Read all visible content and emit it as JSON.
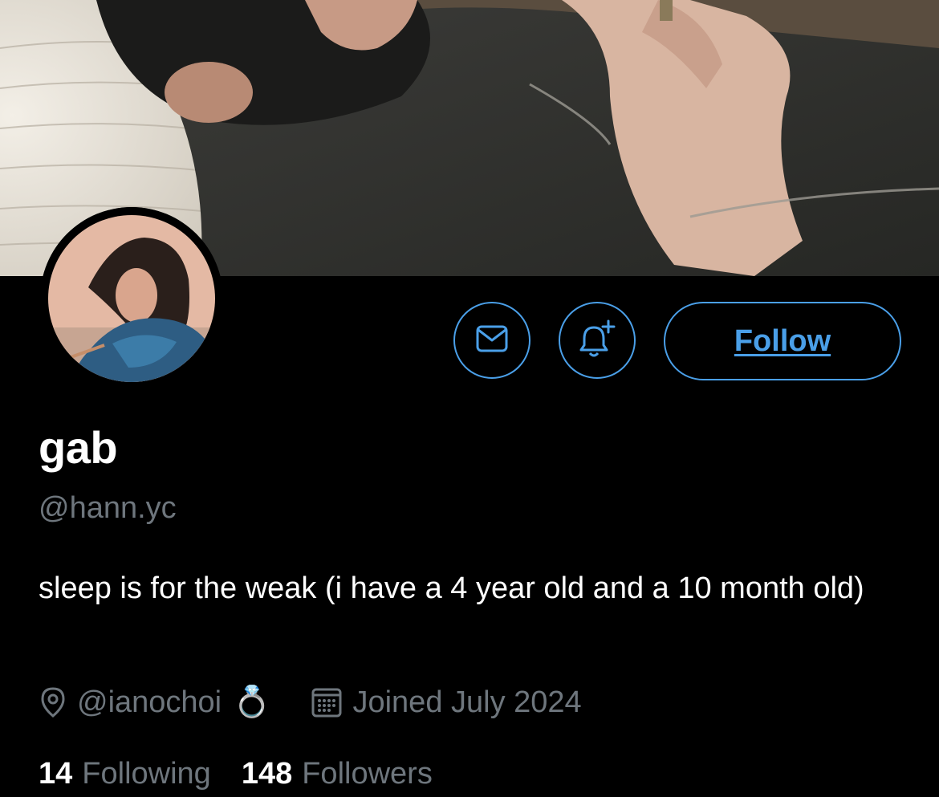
{
  "profile": {
    "display_name": "gab",
    "handle": "@hann.yc",
    "bio": "sleep is for the weak (i have a 4 year old and a 10 month old)",
    "location": "@ianochoi",
    "location_emoji": "💍",
    "joined": "Joined July 2024"
  },
  "actions": {
    "follow_label": "Follow"
  },
  "stats": {
    "following_count": "14",
    "following_label": "Following",
    "followers_count": "148",
    "followers_label": "Followers"
  },
  "icons": {
    "message": "envelope-icon",
    "notifications": "bell-plus-icon",
    "location": "location-pin-icon",
    "joined": "calendar-icon"
  },
  "colors": {
    "accent": "#4a9fe8",
    "secondary_text": "#6e767d",
    "background": "#000000"
  }
}
